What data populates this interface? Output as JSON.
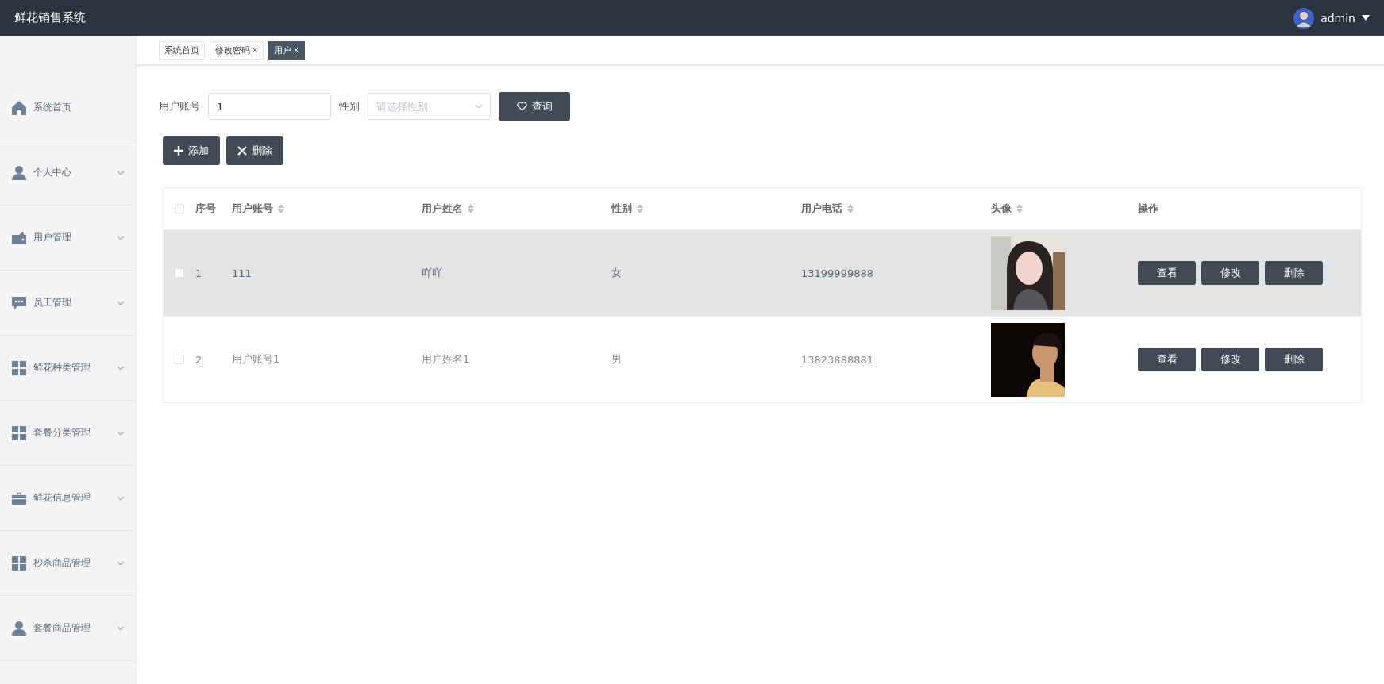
{
  "header": {
    "title": "鲜花销售系统",
    "user": "admin"
  },
  "sidebar": {
    "items": [
      {
        "label": "系统首页",
        "expandable": false
      },
      {
        "label": "个人中心",
        "expandable": true
      },
      {
        "label": "用户管理",
        "expandable": true
      },
      {
        "label": "员工管理",
        "expandable": true
      },
      {
        "label": "鲜花种类管理",
        "expandable": true
      },
      {
        "label": "套餐分类管理",
        "expandable": true
      },
      {
        "label": "鲜花信息管理",
        "expandable": true
      },
      {
        "label": "秒杀商品管理",
        "expandable": true
      },
      {
        "label": "套餐商品管理",
        "expandable": true
      }
    ]
  },
  "tabs": [
    {
      "label": "系统首页",
      "closable": false,
      "selected": false
    },
    {
      "label": "修改密码",
      "closable": true,
      "selected": false
    },
    {
      "label": "用户",
      "closable": true,
      "selected": true
    }
  ],
  "search": {
    "fields": [
      {
        "label": "用户账号",
        "kind": "input",
        "value": "1"
      },
      {
        "label": "性别",
        "kind": "select",
        "placeholder": "请选择性别"
      }
    ],
    "button": "查询"
  },
  "actions": [
    {
      "label": "添加"
    },
    {
      "label": "删除"
    }
  ],
  "table": {
    "columns": [
      {
        "label": "序号",
        "sortable": false
      },
      {
        "label": "用户账号",
        "sortable": true
      },
      {
        "label": "用户姓名",
        "sortable": true
      },
      {
        "label": "性别",
        "sortable": true
      },
      {
        "label": "用户电话",
        "sortable": true
      },
      {
        "label": "头像",
        "sortable": true
      },
      {
        "label": "操作",
        "sortable": false
      }
    ],
    "select_all": false,
    "rows": [
      {
        "checked": false,
        "hovered": true,
        "cells": [
          "1",
          "111",
          "吖吖",
          "女",
          "13199999888"
        ],
        "buttons": [
          "查看",
          "修改",
          "删除"
        ]
      },
      {
        "checked": false,
        "hovered": false,
        "cells": [
          "2",
          "用户账号1",
          "用户姓名1",
          "男",
          "13823888881"
        ],
        "buttons": [
          "查看",
          "修改",
          "删除"
        ]
      }
    ]
  }
}
